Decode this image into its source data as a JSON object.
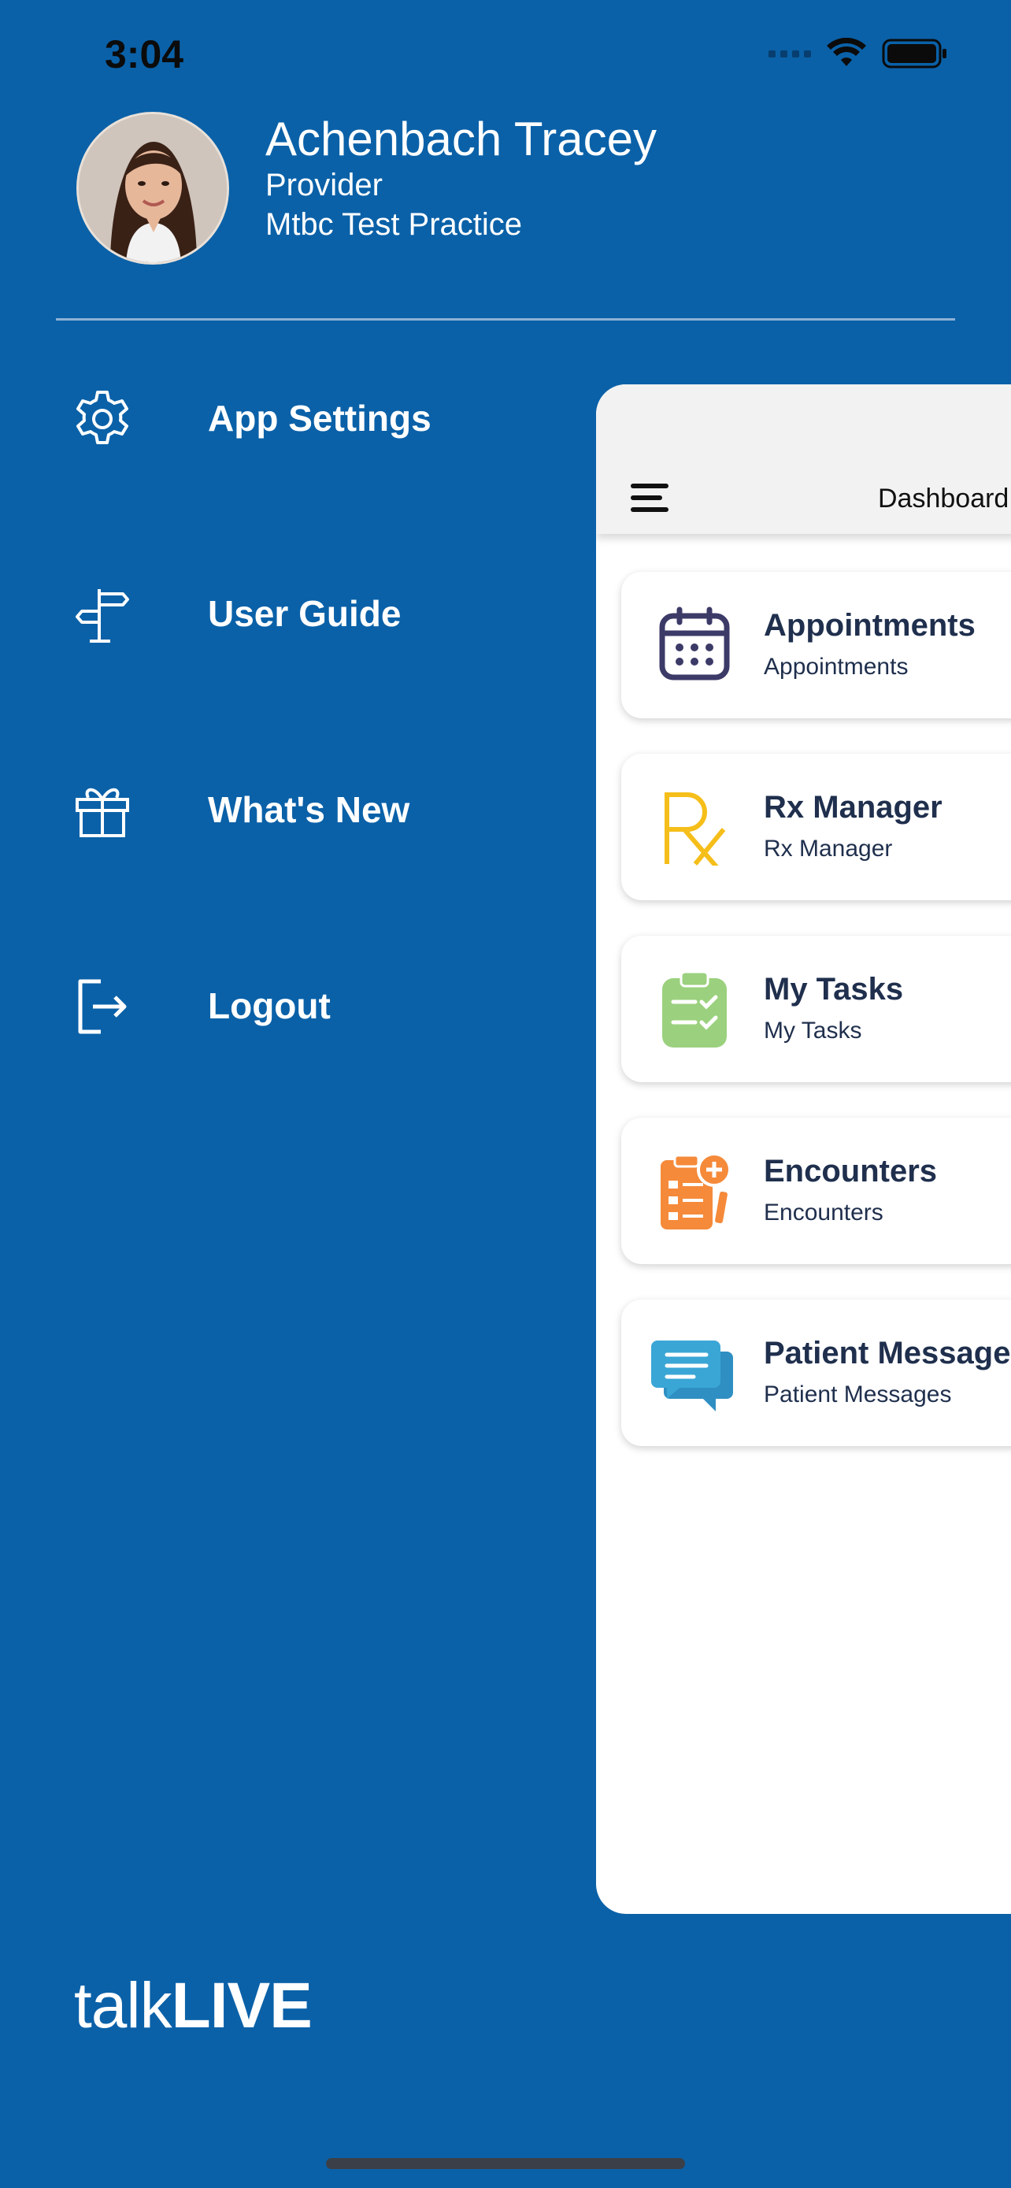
{
  "status_bar": {
    "time": "3:04"
  },
  "profile": {
    "name": "Achenbach Tracey",
    "role": "Provider",
    "practice": "Mtbc Test Practice"
  },
  "menu": [
    {
      "label": "App Settings",
      "icon": "gear-icon"
    },
    {
      "label": "User Guide",
      "icon": "signpost-icon"
    },
    {
      "label": "What's New",
      "icon": "gift-icon"
    },
    {
      "label": "Logout",
      "icon": "logout-icon"
    }
  ],
  "brand": {
    "light": "talk",
    "bold": "LIVE"
  },
  "dashboard": {
    "title": "Dashboard",
    "cards": [
      {
        "title": "Appointments",
        "subtitle": "Appointments",
        "icon": "calendar-icon",
        "color": "#3c3a67"
      },
      {
        "title": "Rx Manager",
        "subtitle": "Rx Manager",
        "icon": "rx-icon",
        "color": "#f5be1a"
      },
      {
        "title": "My Tasks",
        "subtitle": "My Tasks",
        "icon": "clipboard-check-icon",
        "color": "#9bd17e"
      },
      {
        "title": "Encounters",
        "subtitle": "Encounters",
        "icon": "encounter-document-icon",
        "color": "#f58a3a"
      },
      {
        "title": "Patient Messages",
        "subtitle": "Patient Messages",
        "icon": "chat-bubbles-icon",
        "color": "#3aa6d6"
      }
    ]
  },
  "colors": {
    "background": "#0a61a8",
    "panel": "#ffffff",
    "card_text": "#1f2f4d"
  }
}
